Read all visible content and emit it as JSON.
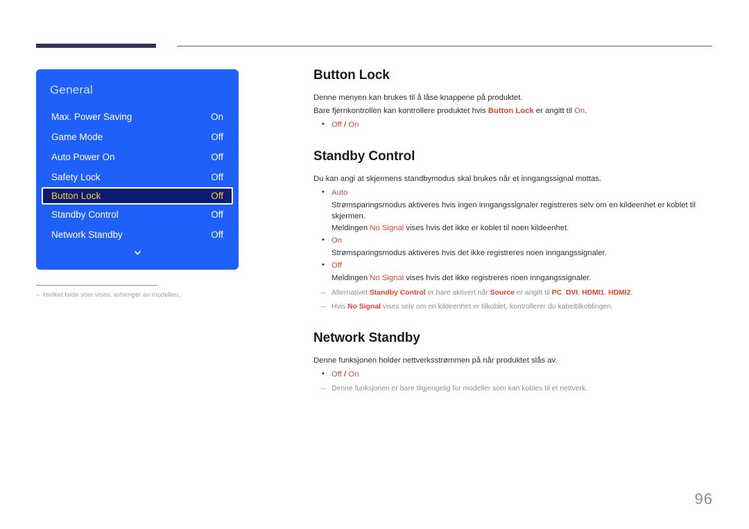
{
  "page": {
    "number": "96"
  },
  "colors": {
    "panel_blue": "#1F60FA",
    "selected_row_bg": "#0B1D73",
    "selected_row_text": "#FFC83C",
    "accent_orange": "#E8452B",
    "rule_navy": "#2F3659",
    "note_gray": "#8E8E8E"
  },
  "osd": {
    "title": "General",
    "rows": [
      {
        "label": "Max. Power Saving",
        "value": "On",
        "selected": false
      },
      {
        "label": "Game Mode",
        "value": "Off",
        "selected": false
      },
      {
        "label": "Auto Power On",
        "value": "Off",
        "selected": false
      },
      {
        "label": "Safety Lock",
        "value": "Off",
        "selected": false
      },
      {
        "label": "Button Lock",
        "value": "Off",
        "selected": true
      },
      {
        "label": "Standby Control",
        "value": "Off",
        "selected": false
      },
      {
        "label": "Network Standby",
        "value": "Off",
        "selected": false
      }
    ],
    "more_icon": "chevron-down-icon",
    "caption_dash": "–",
    "caption": "Hvilket bilde som vises, avhenger av modellen."
  },
  "sections": {
    "button_lock": {
      "title": "Button Lock",
      "line1": "Denne menyen kan brukes til å låse knappene på produktet.",
      "line2_a": "Bare fjernkontrollen kan kontrollere produktet hvis ",
      "line2_term": "Button Lock",
      "line2_b": " er angitt til ",
      "line2_value": "On",
      "line2_c": ".",
      "option_off": "Off",
      "option_sep": " / ",
      "option_on": "On"
    },
    "standby_control": {
      "title": "Standby Control",
      "intro": "Du kan angi at skjermens standbymodus skal brukes når et inngangssignal mottas.",
      "auto": {
        "head": "Auto",
        "sub1": "Strømsparingsmodus aktiveres hvis ingen inngangssignaler registreres selv om en kildeenhet er koblet til skjermen.",
        "sub2_a": "Meldingen ",
        "sub2_term": "No Signal",
        "sub2_b": " vises hvis det ikke er koblet til noen kildeenhet."
      },
      "on": {
        "head": "On",
        "sub1": "Strømsparingsmodus aktiveres hvis det ikke registreres noen inngangssignaler."
      },
      "off": {
        "head": "Off",
        "sub1_a": "Meldingen ",
        "sub1_term": "No Signal",
        "sub1_b": " vises hvis det ikke registreres noen inngangssignaler."
      },
      "note1": {
        "a": "Alternativet ",
        "term1": "Standby Control",
        "b": " er bare aktivert når ",
        "term2": "Source",
        "c": " er angitt til ",
        "term3": "PC",
        "d": ", ",
        "term4": "DVI",
        "e": ", ",
        "term5": "HDMI1",
        "f": ", ",
        "term6": "HDMI2",
        "g": "."
      },
      "note2": {
        "a": "Hvis ",
        "term1": "No Signal",
        "b": " vises selv om en kildeenhet er tilkoblet, kontrollerer du kabeltilkoblingen."
      }
    },
    "network_standby": {
      "title": "Network Standby",
      "intro": "Denne funksjonen holder nettverksstrømmen på når produktet slås av.",
      "option_off": "Off",
      "option_sep": " / ",
      "option_on": "On",
      "note": "Denne funksjonen er bare tilgjengelig for modeller som kan kobles til et nettverk."
    }
  }
}
